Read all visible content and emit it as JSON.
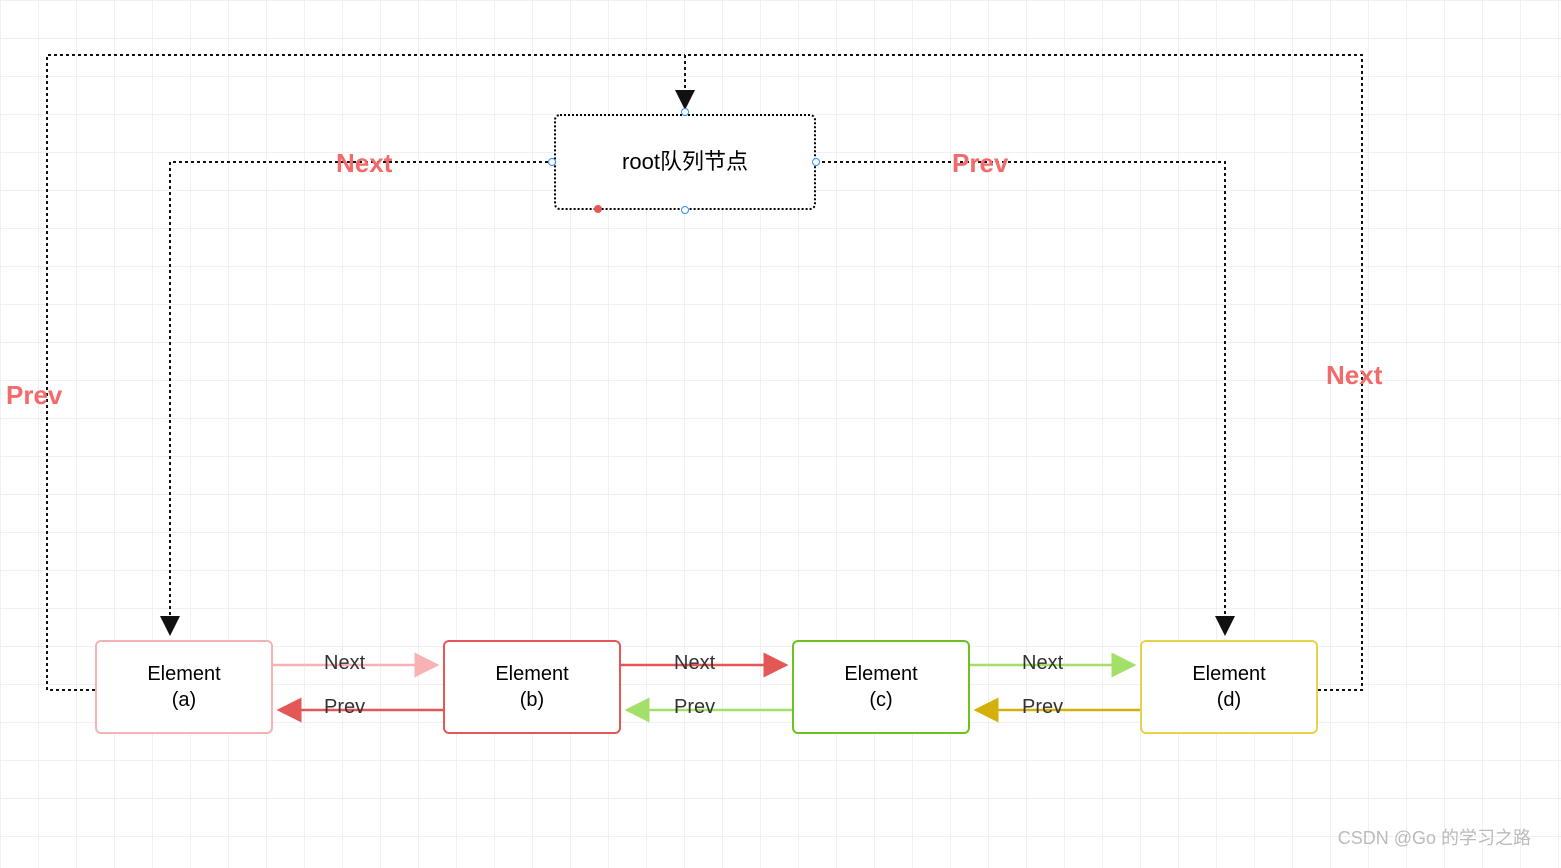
{
  "root": {
    "label": "root队列节点"
  },
  "elements": {
    "a": {
      "title": "Element",
      "sub": "(a)"
    },
    "b": {
      "title": "Element",
      "sub": "(b)"
    },
    "c": {
      "title": "Element",
      "sub": "(c)"
    },
    "d": {
      "title": "Element",
      "sub": "(d)"
    }
  },
  "labels": {
    "rootNext": "Next",
    "rootPrev": "Prev",
    "leftPrev": "Prev",
    "rightNext": "Next",
    "ab_next": "Next",
    "ab_prev": "Prev",
    "bc_next": "Next",
    "bc_prev": "Prev",
    "cd_next": "Next",
    "cd_prev": "Prev"
  },
  "watermark": "CSDN @Go 的学习之路"
}
